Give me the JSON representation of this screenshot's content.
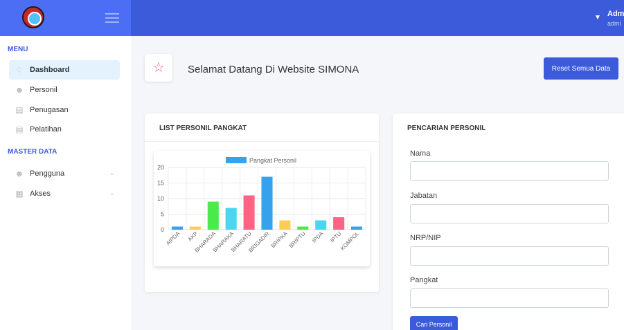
{
  "header": {
    "user_name": "Admi",
    "user_role": "admi"
  },
  "sidebar": {
    "menu_title": "MENU",
    "master_title": "MASTER DATA",
    "items": [
      {
        "label": "Dashboard",
        "icon": "bell-icon",
        "active": true
      },
      {
        "label": "Personil",
        "icon": "users-icon",
        "active": false
      },
      {
        "label": "Penugasan",
        "icon": "clipboard-icon",
        "active": false
      },
      {
        "label": "Pelatihan",
        "icon": "document-icon",
        "active": false
      }
    ],
    "master_items": [
      {
        "label": "Pengguna",
        "icon": "users-icon"
      },
      {
        "label": "Akses",
        "icon": "calendar-icon"
      }
    ]
  },
  "welcome": {
    "text": "Selamat Datang Di Website SIMONA",
    "reset_button": "Reset Semua Data"
  },
  "list_card": {
    "title": "LIST PERSONIL PANGKAT"
  },
  "search_card": {
    "title": "PENCARIAN PERSONIL",
    "fields": [
      {
        "label": "Nama",
        "value": ""
      },
      {
        "label": "Jabatan",
        "value": ""
      },
      {
        "label": "NRP/NIP",
        "value": ""
      },
      {
        "label": "Pangkat",
        "value": ""
      }
    ],
    "button": "Cari Personil"
  },
  "chart_data": {
    "type": "bar",
    "title": "",
    "categories": [
      "AIPDA",
      "AKP",
      "BHARADA",
      "BHARAKA",
      "BHARATU",
      "BRIGADIR",
      "BRIPKA",
      "BRIPTU",
      "IPDA",
      "IPTU",
      "KOMPOL"
    ],
    "series": [
      {
        "name": "Pangkat Personil",
        "values": [
          1,
          1,
          9,
          7,
          11,
          17,
          3,
          1,
          3,
          4,
          1
        ]
      }
    ],
    "colors": [
      "#36a2eb",
      "#ffcd56",
      "#4bea4b",
      "#4bd6f0",
      "#ff6384",
      "#36a2eb",
      "#ffcd56",
      "#4bea4b",
      "#4bd6f0",
      "#ff6384",
      "#36a2eb"
    ],
    "legend_color": "#36a2eb",
    "xlabel": "",
    "ylabel": "",
    "ylim": [
      0,
      20
    ],
    "yticks": [
      "0",
      "5",
      "10",
      "15",
      "20"
    ],
    "grid": true,
    "legend_position": "top"
  }
}
